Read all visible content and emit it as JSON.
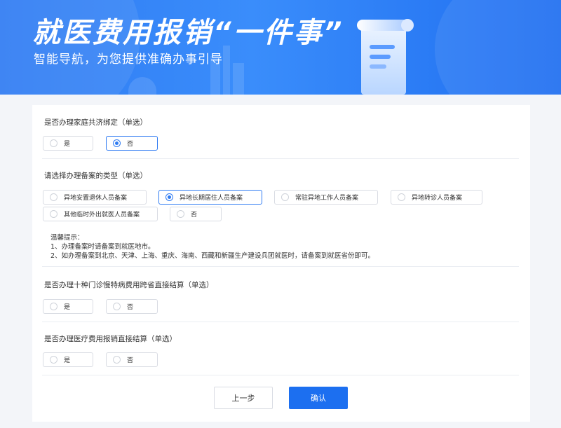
{
  "banner": {
    "title": "就医费用报销“一件事”",
    "subtitle": "智能导航，为您提供准确办事引导"
  },
  "questions": [
    {
      "label": "是否办理家庭共济绑定（单选）",
      "options": [
        {
          "label": "是",
          "selected": false
        },
        {
          "label": "否",
          "selected": true
        }
      ]
    },
    {
      "label": "请选择办理备案的类型（单选）",
      "options": [
        {
          "label": "异地安置退休人员备案",
          "selected": false
        },
        {
          "label": "异地长期居住人员备案",
          "selected": true
        },
        {
          "label": "常驻异地工作人员备案",
          "selected": false
        },
        {
          "label": "异地转诊人员备案",
          "selected": false
        },
        {
          "label": "其他临时外出就医人员备案",
          "selected": false
        },
        {
          "label": "否",
          "selected": false
        }
      ]
    },
    {
      "label": "是否办理十种门诊慢特病费用跨省直接结算（单选）",
      "options": [
        {
          "label": "是",
          "selected": false
        },
        {
          "label": "否",
          "selected": false
        }
      ]
    },
    {
      "label": "是否办理医疗费用报销直接结算（单选）",
      "options": [
        {
          "label": "是",
          "selected": false
        },
        {
          "label": "否",
          "selected": false
        }
      ]
    }
  ],
  "tips": {
    "title": "温馨提示：",
    "lines": [
      "1、办理备案时请备案到就医地市。",
      "2、如办理备案到北京、天津、上海、重庆、海南、西藏和新疆生产建设兵团就医时，请备案到就医省份即可。"
    ]
  },
  "buttons": {
    "prev": "上一步",
    "confirm": "确认"
  },
  "colors": {
    "accent": "#2f7bf2",
    "banner": "#3a8dfb",
    "confirm": "#1c6ff0"
  }
}
